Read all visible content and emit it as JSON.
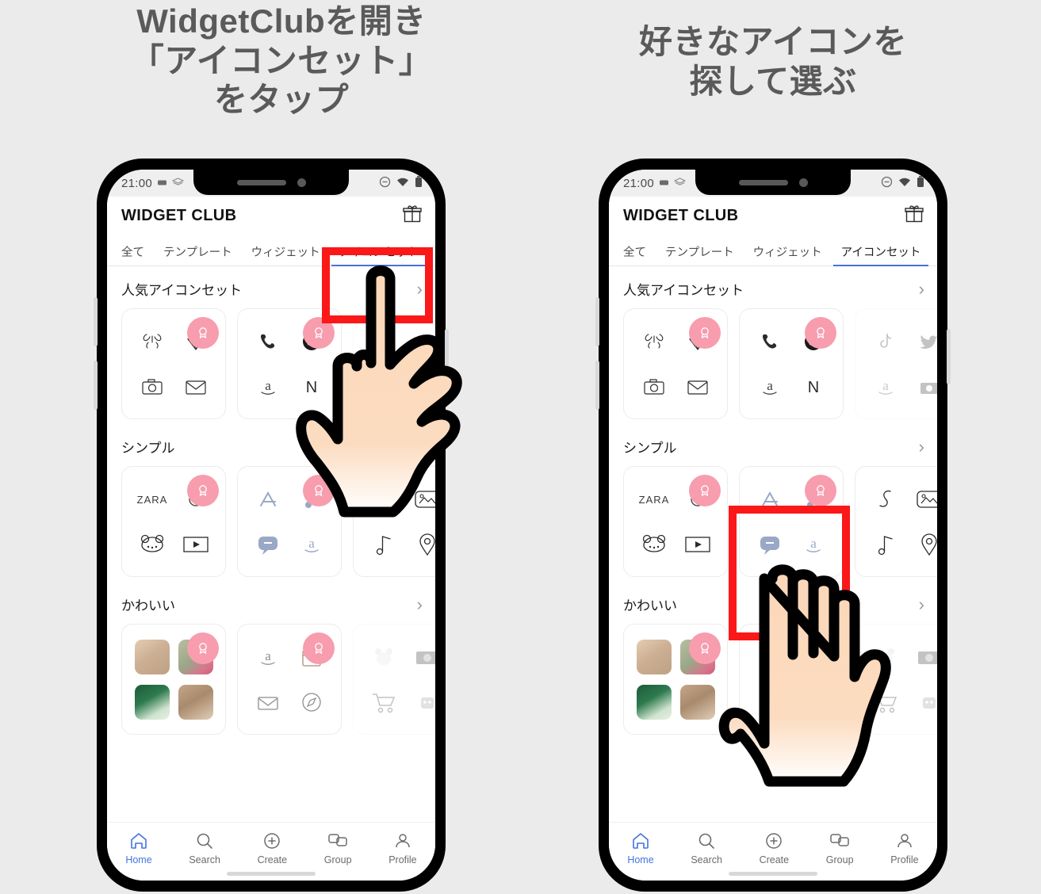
{
  "page": {
    "background_color": "#ebebeb",
    "highlight_color": "#fb1818",
    "accent_color": "#4273e0",
    "badge_color": "#f79dae"
  },
  "captions": {
    "left": "WidgetClubを開き\n「アイコンセット」\nをタップ",
    "right": "好きなアイコンを\n探して選ぶ"
  },
  "status_bar": {
    "time": "21:00",
    "left_icons": [
      "notification-icon",
      "layers-icon"
    ],
    "right_icons": [
      "do-not-disturb-icon",
      "wifi-icon",
      "battery-icon"
    ]
  },
  "app_header": {
    "title": "WIDGET CLUB",
    "action_icon": "gift-icon"
  },
  "tabs": [
    {
      "label": "全て",
      "active": false
    },
    {
      "label": "テンプレート",
      "active": false
    },
    {
      "label": "ウィジェット",
      "active": false
    },
    {
      "label": "アイコンセット",
      "active": true
    }
  ],
  "sections": [
    {
      "title": "人気アイコンセット",
      "chevron": "chevron-right-icon",
      "cards": [
        {
          "icons": [
            "butterfly-icon",
            "diamond-icon",
            "camera-icon",
            "mail-icon"
          ],
          "badge": true,
          "faded": false
        },
        {
          "icons": [
            "phone-icon",
            "spotify-icon",
            "amazon-icon",
            "netflix-icon"
          ],
          "badge": true,
          "faded": false
        },
        {
          "icons": [
            "tiktok-icon",
            "twitter-icon",
            "amazon-icon",
            "camera-icon"
          ],
          "badge": false,
          "faded": true
        }
      ]
    },
    {
      "title": "シンプル",
      "chevron": "chevron-right-icon",
      "cards": [
        {
          "icons": [
            "zara-icon",
            "clock-icon",
            "bear-icon",
            "youtube-icon"
          ],
          "badge": true,
          "faded": false
        },
        {
          "icons": [
            "appstore-icon",
            "music-note-icon",
            "messages-icon",
            "amazon-icon"
          ],
          "badge": true,
          "faded": false
        },
        {
          "icons": [
            "phone-curve-icon",
            "photos-icon",
            "music-note-icon",
            "maps-pin-icon"
          ],
          "badge": false,
          "faded": false
        }
      ]
    },
    {
      "title": "かわいい",
      "chevron": "chevron-right-icon",
      "cards": [
        {
          "icons": [
            "photo-teddy",
            "photo-flower",
            "photo-tulips",
            "photo-room"
          ],
          "badge": true,
          "faded": false,
          "photo": true
        },
        {
          "icons": [
            "amazon-icon",
            "calendar-icon",
            "mail-icon",
            "safari-icon"
          ],
          "badge": true,
          "faded": false
        },
        {
          "icons": [
            "bear-plush-icon",
            "camera-retro-icon",
            "cart-icon",
            "robot-icon"
          ],
          "badge": false,
          "faded": true
        }
      ]
    }
  ],
  "bottom_nav": [
    {
      "label": "Home",
      "icon": "home-icon",
      "active": true
    },
    {
      "label": "Search",
      "icon": "search-icon",
      "active": false
    },
    {
      "label": "Create",
      "icon": "plus-circle-icon",
      "active": false
    },
    {
      "label": "Group",
      "icon": "chat-bubbles-icon",
      "active": false
    },
    {
      "label": "Profile",
      "icon": "person-icon",
      "active": false
    }
  ],
  "annotations": {
    "left_highlight_target": "アイコンセット",
    "right_highlight_target": "シンプル card 2"
  }
}
